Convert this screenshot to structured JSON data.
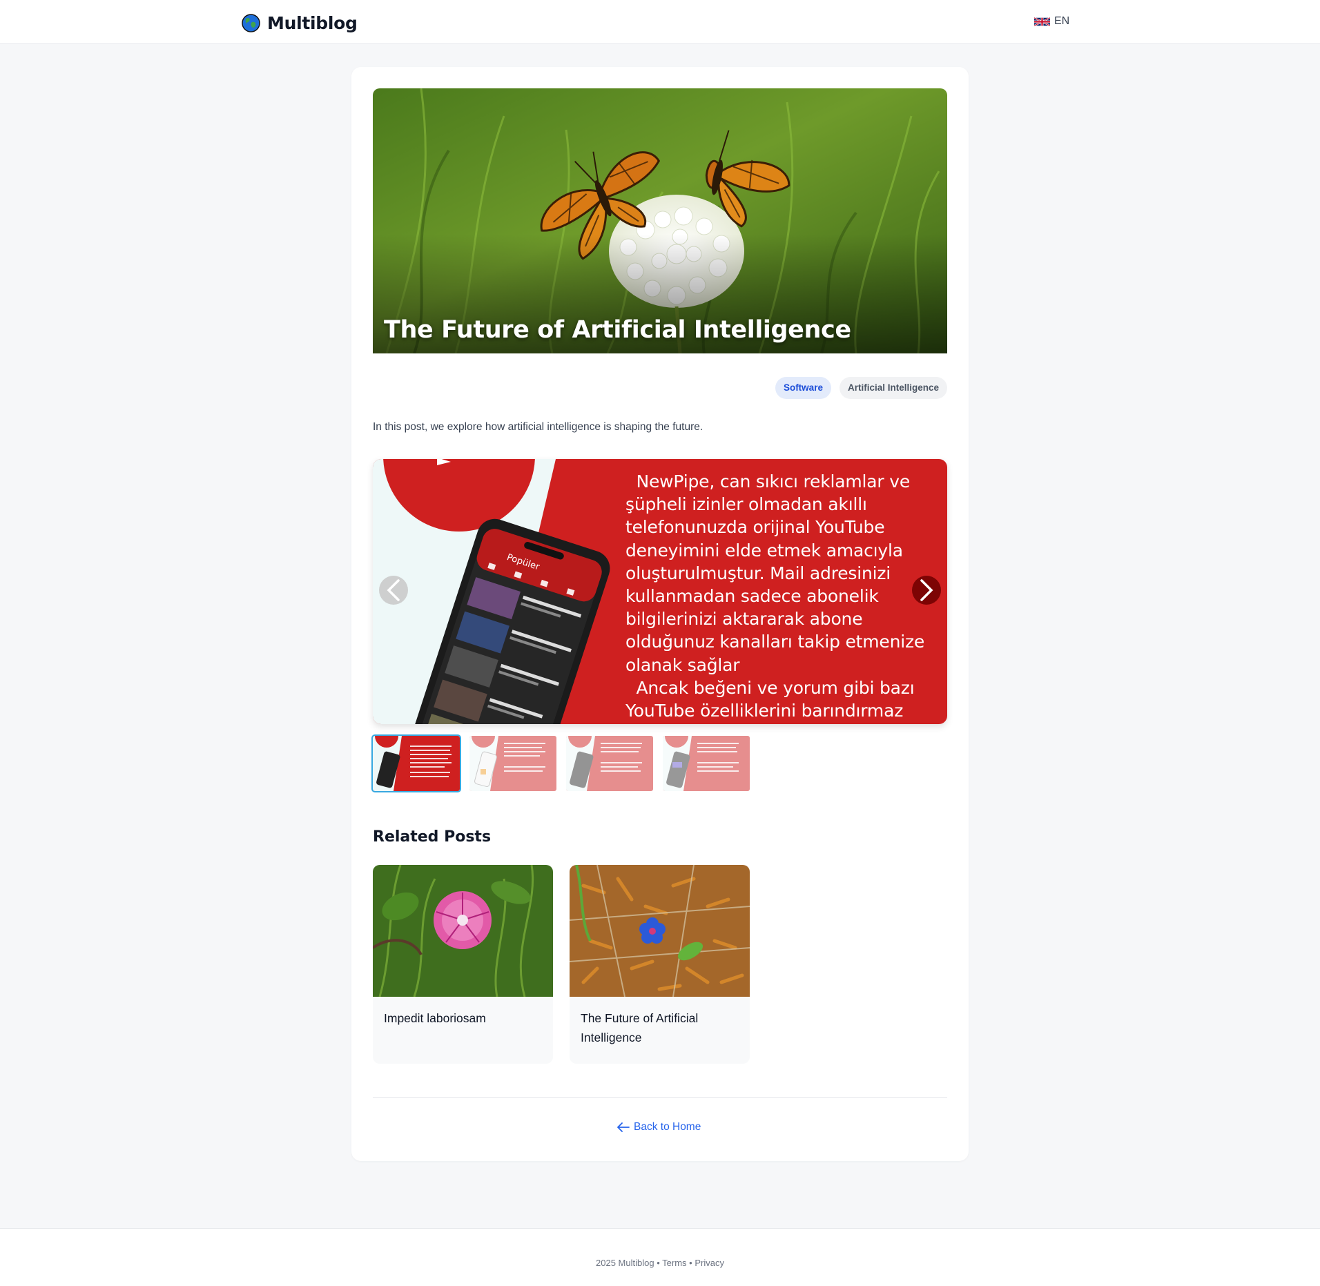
{
  "header": {
    "brand": "Multiblog",
    "language": "EN"
  },
  "post": {
    "title": "The Future of Artificial Intelligence",
    "tags": [
      "Software",
      "Artificial Intelligence"
    ],
    "intro": "In this post, we explore how artificial intelligence is shaping the future."
  },
  "carousel": {
    "slide_text": "  NewPipe, can sıkıcı reklamlar ve şüpheli izinler olmadan akıllı telefonunuzda orijinal YouTube deneyimini elde etmek amacıyla oluşturulmuştur. Mail adresinizi kullanmadan sadece abonelik bilgilerinizi aktararak abone olduğunuz kanalları takip etmenize olanak sağlar\n  Ancak beğeni ve yorum gibi bazı YouTube özelliklerini barındırmaz",
    "app_header": "Popüler",
    "thumbnail_count": 4,
    "active_index": 0
  },
  "related": {
    "heading": "Related Posts",
    "posts": [
      {
        "title": "Impedit laboriosam"
      },
      {
        "title": "The Future of Artificial Intelligence"
      }
    ]
  },
  "back_link": "Back to Home",
  "footer": {
    "copyright": "2025 Multiblog",
    "separator": "•",
    "terms": "Terms",
    "privacy": "Privacy"
  },
  "colors": {
    "accent": "#2563eb",
    "slide_red": "#cf2020",
    "active_thumb_border": "#38a8e0"
  }
}
